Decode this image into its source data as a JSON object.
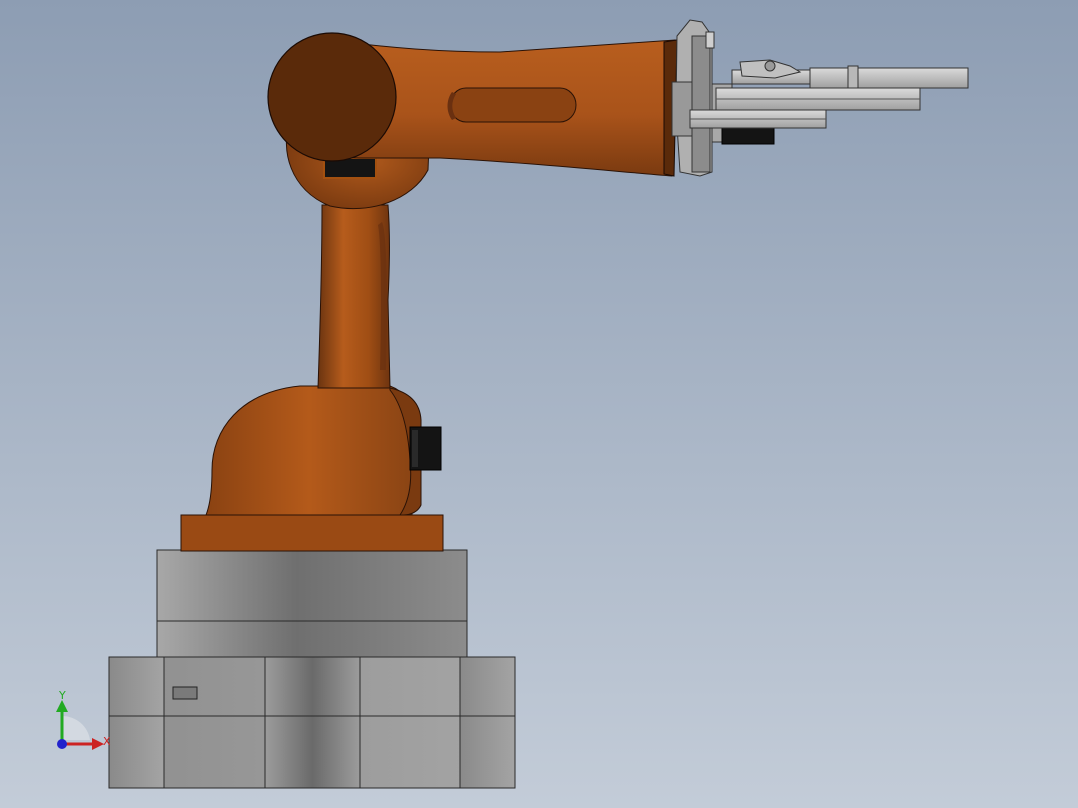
{
  "viewport": {
    "background_top": "#8d9db3",
    "background_bottom": "#c3ccd8"
  },
  "model": {
    "arm_color": "#b45a1a",
    "arm_color_dark": "#5a2a0a",
    "base_color": "#9a9a9a",
    "gripper_color": "#c8c8c8",
    "motor_color": "#141414"
  },
  "triad": {
    "y_label": "Y",
    "x_label": "X",
    "y_color": "#22aa22",
    "x_color": "#cc2222",
    "z_color": "#2222cc"
  }
}
